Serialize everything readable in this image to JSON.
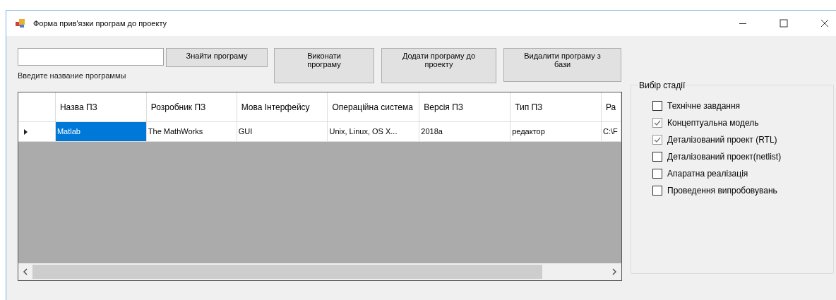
{
  "window": {
    "title": "Форма прив'язки програм до проекту"
  },
  "search": {
    "label": "Введите название программы"
  },
  "buttons": [
    "Знайти програму",
    "Виконати програму",
    "Додати програму до проекту",
    "Видалити програму з бази"
  ],
  "table": {
    "columns": [
      "Назва ПЗ",
      "Розробник ПЗ",
      "Мова Інтерфейсу",
      "Операційна система",
      "Версія ПЗ",
      "Тип ПЗ",
      "Ра"
    ],
    "rows": [
      {
        "current": true,
        "cells": [
          {
            "text": "Matlab",
            "selected": true
          },
          {
            "text": "The MathWorks",
            "selected": false
          },
          {
            "text": "GUI",
            "selected": false
          },
          {
            "text": "Unix, Linux, OS X...",
            "selected": false
          },
          {
            "text": "2018a",
            "selected": false
          },
          {
            "text": "редактор",
            "selected": false
          },
          {
            "text": "C:\\F",
            "selected": false
          }
        ]
      }
    ]
  },
  "stage_group": {
    "title": "Вибір стадії",
    "options": [
      {
        "label": "Технічне завдання",
        "checked": false
      },
      {
        "label": "Концептуальна модель",
        "checked": true
      },
      {
        "label": "Деталізований проект (RTL)",
        "checked": true
      },
      {
        "label": "Деталізований проект(netlist)",
        "checked": false
      },
      {
        "label": "Апаратна реалізація",
        "checked": false
      },
      {
        "label": "Проведення випробовувань",
        "checked": false
      }
    ]
  }
}
